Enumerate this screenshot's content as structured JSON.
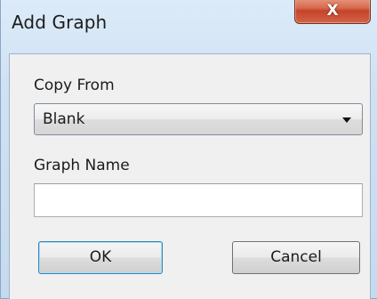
{
  "window": {
    "title": "Add Graph",
    "close_glyph": "X"
  },
  "form": {
    "copy_from_label": "Copy From",
    "copy_from_value": "Blank",
    "graph_name_label": "Graph Name",
    "graph_name_value": ""
  },
  "buttons": {
    "ok_label": "OK",
    "cancel_label": "Cancel"
  },
  "icons": {
    "close": "close-icon",
    "dropdown": "chevron-down-icon"
  }
}
